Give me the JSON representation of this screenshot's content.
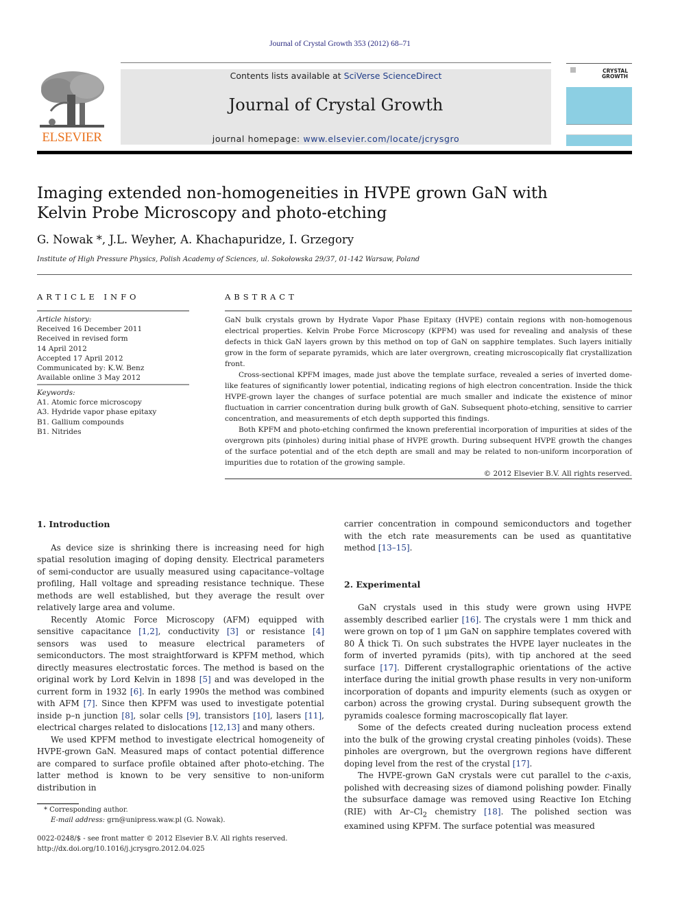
{
  "header": {
    "citation": "Journal of Crystal Growth 353 (2012) 68–71",
    "contents_prefix": "Contents lists available at ",
    "contents_link": "SciVerse ScienceDirect",
    "journal_title": "Journal of Crystal Growth",
    "homepage_prefix": "journal homepage: ",
    "homepage_link": "www.elsevier.com/locate/jcrysgro",
    "publisher_logo_text": "ELSEVIER",
    "cover_label_line1": "CRYSTAL",
    "cover_label_line2": "GROWTH",
    "colors": {
      "publisher_orange": "#e9711c",
      "link_blue": "#1f3c88",
      "cover_blue": "#8ccfe3",
      "banner_gray": "#e6e6e6"
    }
  },
  "article": {
    "title_line1": "Imaging extended non-homogeneities in HVPE grown GaN with",
    "title_line2": "Kelvin Probe Microscopy and photo-etching",
    "authors": "G. Nowak *, J.L. Weyher, A. Khachapuridze, I. Grzegory",
    "affiliation": "Institute of High Pressure Physics, Polish Academy of Sciences, ul. Sokołowska 29/37, 01-142 Warsaw, Poland"
  },
  "article_info": {
    "heading": "ARTICLE INFO",
    "history_label": "Article history:",
    "history": [
      "Received 16 December 2011",
      "Received in revised form",
      "14 April 2012",
      "Accepted 17 April 2012",
      "Communicated by: K.W. Benz",
      "Available online 3 May 2012"
    ],
    "keywords_label": "Keywords:",
    "keywords": [
      "A1. Atomic force microscopy",
      "A3. Hydride vapor phase epitaxy",
      "B1. Gallium compounds",
      "B1. Nitrides"
    ]
  },
  "abstract": {
    "heading": "ABSTRACT",
    "paragraphs": [
      "GaN bulk crystals grown by Hydrate Vapor Phase Epitaxy (HVPE) contain regions with non-homogenous electrical properties. Kelvin Probe Force Microscopy (KPFM) was used for revealing and analysis of these defects in thick GaN layers grown by this method on top of GaN on sapphire templates. Such layers initially grow in the form of separate pyramids, which are later overgrown, creating microscopically flat crystallization front.",
      "Cross-sectional KPFM images, made just above the template surface, revealed a series of inverted dome-like features of significantly lower potential, indicating regions of high electron concentration. Inside the thick HVPE-grown layer the changes of surface potential are much smaller and indicate the existence of minor fluctuation in carrier concentration during bulk growth of GaN. Subsequent photo-etching, sensitive to carrier concentration, and measurements of etch depth supported this findings.",
      "Both KPFM and photo-etching confirmed the known preferential incorporation of impurities at sides of the overgrown pits (pinholes) during initial phase of HVPE growth. During subsequent HVPE growth the changes of the surface potential and of the etch depth are small and may be related to non-uniform incorporation of impurities due to rotation of the growing sample."
    ],
    "copyright": "© 2012 Elsevier B.V. All rights reserved."
  },
  "body": {
    "intro_heading": "1.  Introduction",
    "intro_p1": "As device size is shrinking there is increasing need for high spatial resolution imaging of doping density. Electrical parameters of semi-conductor are usually measured using capacitance–voltage profiling, Hall voltage and spreading resistance technique. These methods are well established, but they average the result over relatively large area and volume.",
    "intro_p2": {
      "t1": "Recently Atomic Force Microscopy (AFM) equipped with sensitive capacitance ",
      "r1": "[1,2]",
      "t2": ", conductivity ",
      "r2": "[3]",
      "t3": " or resistance ",
      "r3": "[4]",
      "t4": " sensors was used to measure electrical parameters of semiconductors. The most straightforward is KPFM method, which directly measures electrostatic forces. The method is based on the original work by Lord Kelvin in 1898 ",
      "r4": "[5]",
      "t5": " and was developed in the current form in 1932 ",
      "r5": "[6]",
      "t6": ". In early 1990s the method was combined with AFM ",
      "r6": "[7]",
      "t7": ". Since then KPFM was used to investigate potential inside p–n junction ",
      "r7": "[8]",
      "t8": ", solar cells ",
      "r8": "[9]",
      "t9": ", transistors ",
      "r9": "[10]",
      "t10": ", lasers ",
      "r10": "[11]",
      "t11": ", electrical charges related to dislocations ",
      "r11": "[12,13]",
      "t12": " and many others."
    },
    "intro_p3": "We used KPFM method to investigate electrical homogeneity of HVPE-grown GaN. Measured maps of contact potential difference are compared to surface profile obtained after photo-etching. The latter method is known to be very sensitive to non-uniform distribution in",
    "right_p0": {
      "t1": "carrier concentration in compound semiconductors and together with the etch rate measurements can be used as quantitative method ",
      "r1": "[13–15]",
      "t2": "."
    },
    "exp_heading": "2.  Experimental",
    "exp_p1": {
      "t1": "GaN crystals used in this study were grown using HVPE assembly described earlier ",
      "r1": "[16]",
      "t2": ". The crystals were 1 mm thick and were grown on top of 1 μm GaN on sapphire templates covered with 80 Å thick Ti. On such substrates the HVPE layer nucleates in the form of inverted pyramids (pits), with tip anchored at the seed surface ",
      "r2": "[17]",
      "t3": ". Different crystallographic orientations of the active interface during the initial growth phase results in very non-uniform incorporation of dopants and impurity elements (such as oxygen or carbon) across the growing crystal. During subsequent growth the pyramids coalesce forming macroscopically flat layer."
    },
    "exp_p2": {
      "t1": "Some of the defects created during nucleation process extend into the bulk of the growing crystal creating pinholes (voids). These pinholes are overgrown, but the overgrown regions have different doping level from the rest of the crystal ",
      "r1": "[17]",
      "t2": "."
    },
    "exp_p3": {
      "t1": "The HVPE-grown GaN crystals were cut parallel to the ",
      "italic": "c",
      "t2": "-axis, polished with decreasing sizes of diamond polishing powder. Finally the subsurface damage was removed using Reactive Ion Etching (RIE) with Ar–Cl",
      "sub": "2",
      "t3": " chemistry ",
      "r1": "[18]",
      "t4": ". The polished section was examined using KPFM. The surface potential was measured"
    }
  },
  "footnotes": {
    "corresponding": "* Corresponding author.",
    "email_label": "E-mail address:",
    "email_value": " grn@unipress.waw.pl (G. Nowak)."
  },
  "bottom": {
    "issn_line": "0022-0248/$ - see front matter © 2012 Elsevier B.V. All rights reserved.",
    "doi": "http://dx.doi.org/10.1016/j.jcrysgro.2012.04.025"
  }
}
